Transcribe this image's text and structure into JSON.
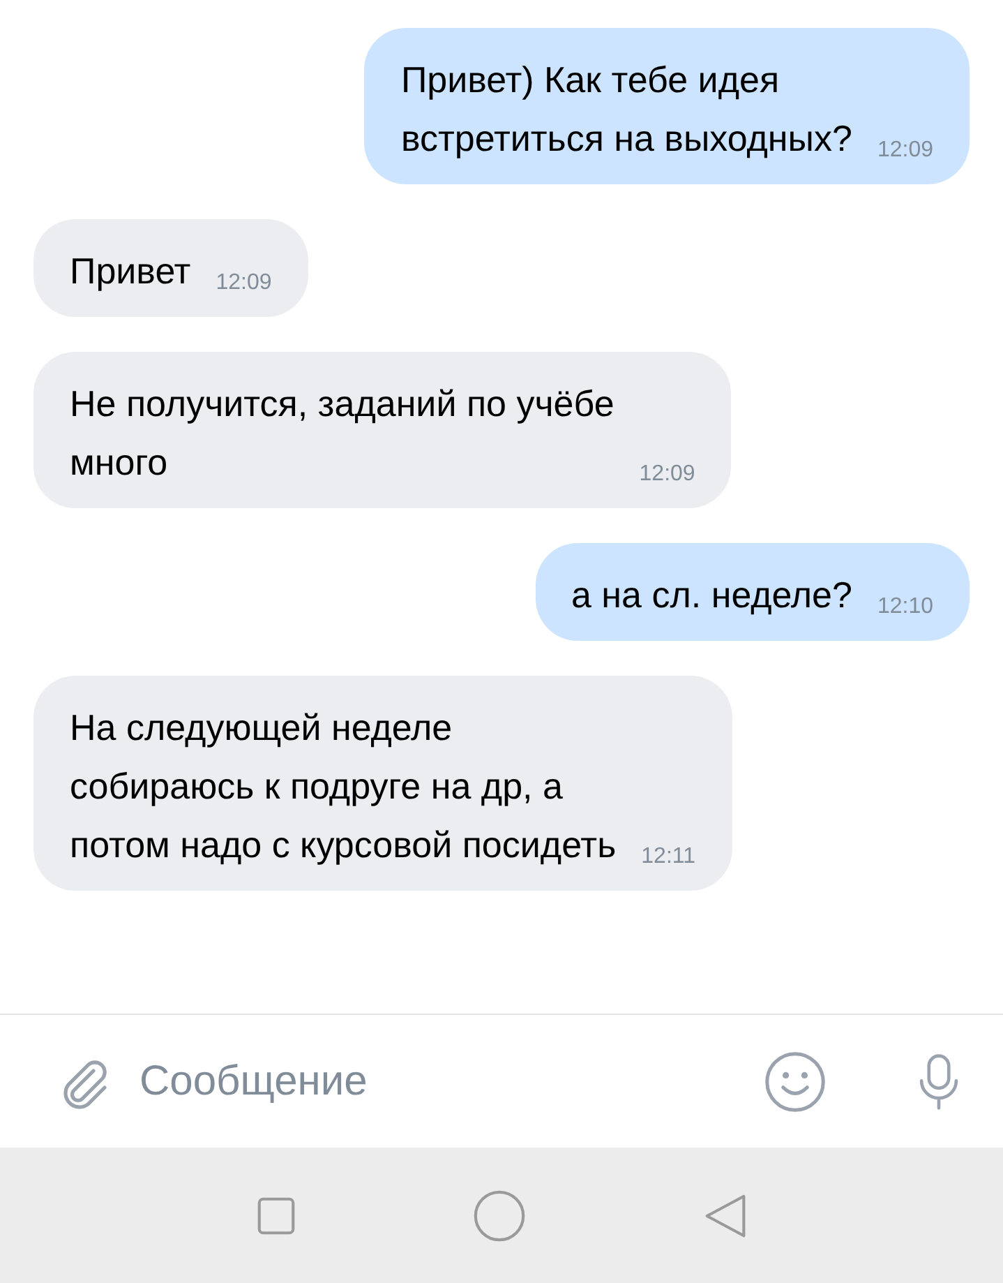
{
  "messages": [
    {
      "kind": "outgoing",
      "text": "Привет) Как тебе идея\nвстретиться на выходных?",
      "time": "12:09"
    },
    {
      "kind": "incoming",
      "text": "Привет",
      "time": "12:09"
    },
    {
      "kind": "incoming",
      "text": "Не получится, заданий по учёбе\nмного",
      "time": "12:09"
    },
    {
      "kind": "outgoing",
      "text": "а на сл. неделе?",
      "time": "12:10"
    },
    {
      "kind": "incoming",
      "text": "На следующей неделе\nсобираюсь к подруге на др, а\nпотом надо с курсовой посидеть",
      "time": "12:11"
    }
  ],
  "composer": {
    "placeholder": "Сообщение"
  }
}
